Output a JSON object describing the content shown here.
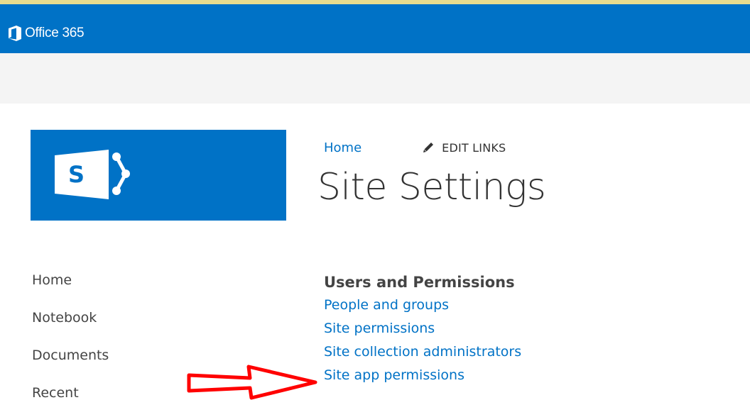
{
  "suite_bar": {
    "title": "Office 365",
    "icon": "office-logo-icon",
    "accent": "#0072c6"
  },
  "site_logo": {
    "icon": "sharepoint-logo-icon",
    "letter": "S",
    "background": "#0072c6"
  },
  "top_nav": {
    "home_label": "Home",
    "edit_links_label": "EDIT LINKS",
    "edit_icon": "pencil-icon"
  },
  "page_title": "Site Settings",
  "quick_launch": {
    "items": [
      {
        "label": "Home"
      },
      {
        "label": "Notebook"
      },
      {
        "label": "Documents"
      },
      {
        "label": "Recent"
      }
    ]
  },
  "users_and_permissions": {
    "heading": "Users and Permissions",
    "links": [
      {
        "label": "People and groups"
      },
      {
        "label": "Site permissions"
      },
      {
        "label": "Site collection administrators"
      },
      {
        "label": "Site app permissions"
      }
    ]
  },
  "annotation": {
    "type": "red-arrow-icon",
    "color": "#ff0000",
    "points_to": "Site app permissions"
  }
}
